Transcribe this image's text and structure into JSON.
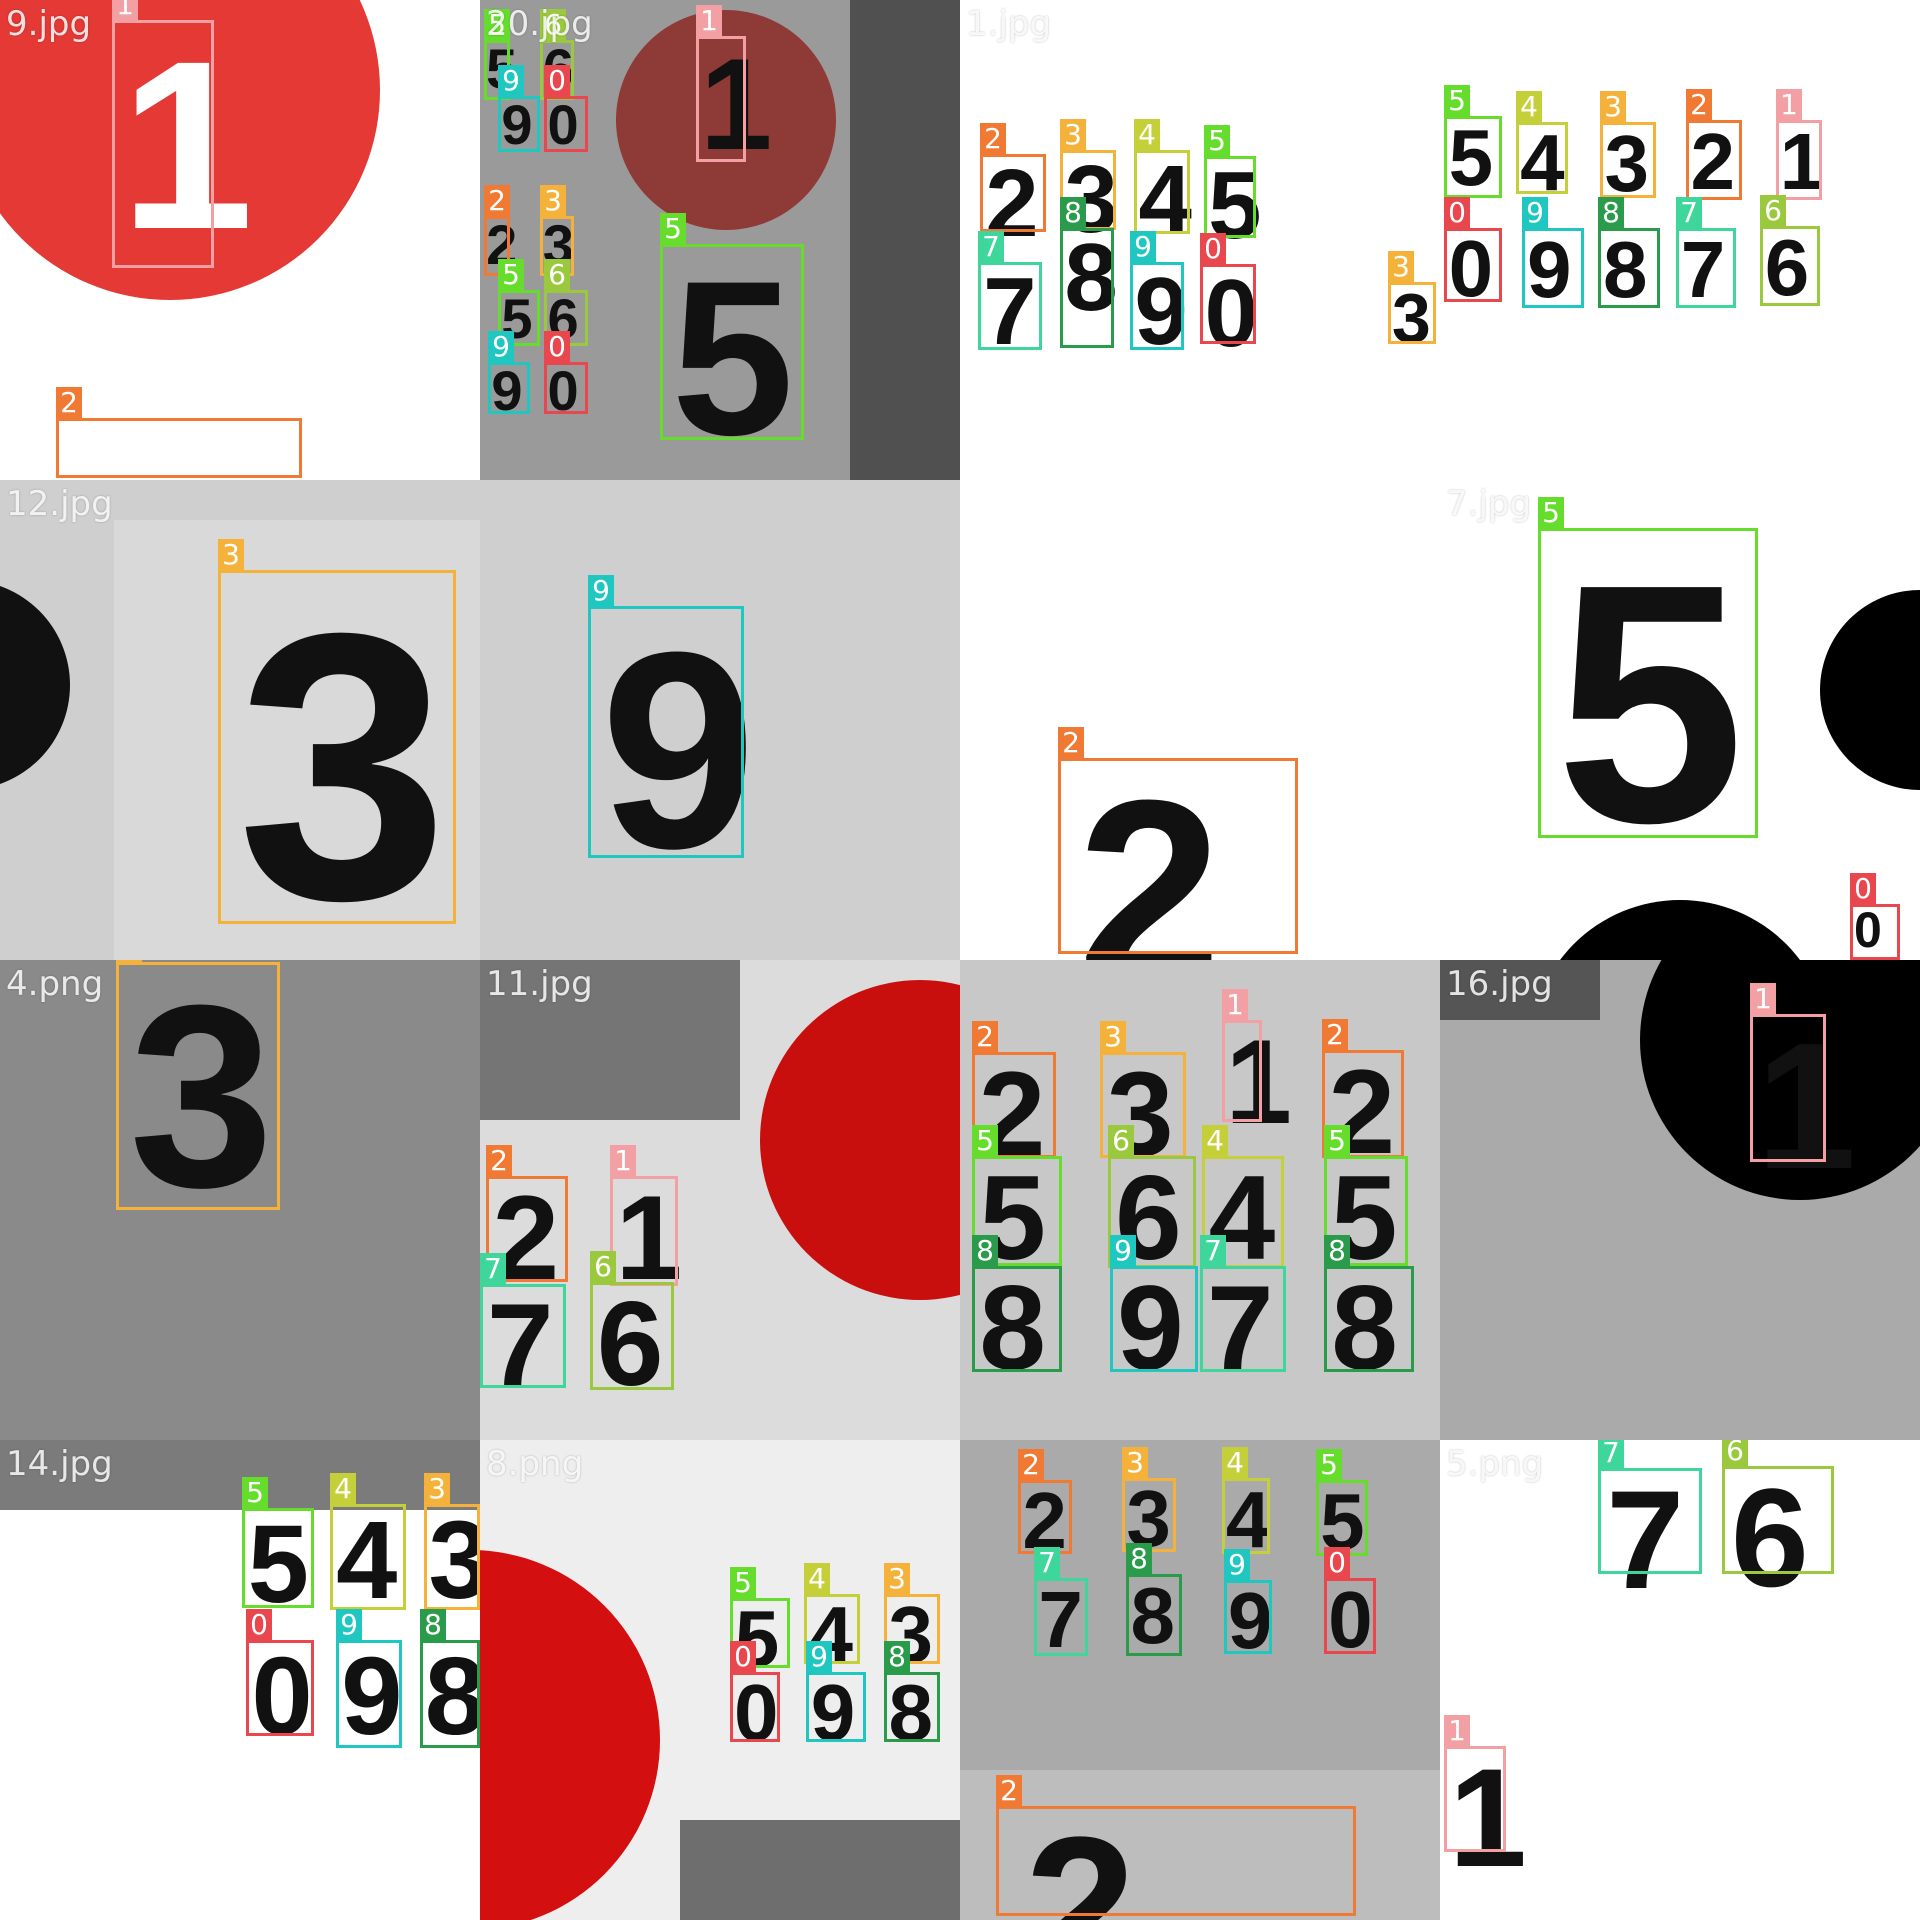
{
  "tiles": [
    {
      "name": "9.jpg",
      "bg": "#ffffff"
    },
    {
      "name": "20.jpg",
      "bg": "#9a9a9a"
    },
    {
      "name": "1.jpg",
      "bg": "#ffffff"
    },
    {
      "name": "",
      "bg": "#ffffff"
    },
    {
      "name": "12.jpg",
      "bg": "#cfcfcf"
    },
    {
      "name": "",
      "bg": "#cfcfcf"
    },
    {
      "name": "",
      "bg": "#ffffff"
    },
    {
      "name": "7.jpg",
      "bg": "#ffffff"
    },
    {
      "name": "4.png",
      "bg": "#8a8a8a"
    },
    {
      "name": "11.jpg",
      "bg": "#dcdcdc"
    },
    {
      "name": "",
      "bg": "#c8c8c8"
    },
    {
      "name": "16.jpg",
      "bg": "#aaaaaa"
    },
    {
      "name": "14.jpg",
      "bg": "#ffffff"
    },
    {
      "name": "8.png",
      "bg": "#eeeeee"
    },
    {
      "name": "",
      "bg": "#aaaaaa"
    },
    {
      "name": "5.png",
      "bg": "#ffffff"
    }
  ],
  "class_colors": {
    "0": "#e8474e",
    "1": "#f2a0a3",
    "2": "#f07a33",
    "3": "#f5b23a",
    "4": "#c5cf3a",
    "5": "#66dd2c",
    "6": "#9bc93d",
    "7": "#3ed69a",
    "8": "#2a9a4b",
    "9": "#1fc7c0"
  },
  "detections": [
    {
      "tile": 0,
      "label": "1",
      "big": true
    },
    {
      "tile": 0,
      "label": "2"
    },
    {
      "tile": 1,
      "label": "1"
    },
    {
      "tile": 1,
      "label": "5"
    },
    {
      "tile": 1,
      "label": "5"
    },
    {
      "tile": 1,
      "label": "6"
    },
    {
      "tile": 1,
      "label": "9"
    },
    {
      "tile": 1,
      "label": "0"
    },
    {
      "tile": 1,
      "label": "2"
    },
    {
      "tile": 1,
      "label": "3"
    },
    {
      "tile": 1,
      "label": "5"
    },
    {
      "tile": 1,
      "label": "6"
    },
    {
      "tile": 1,
      "label": "9"
    },
    {
      "tile": 1,
      "label": "0"
    },
    {
      "tile": 2,
      "label": "2"
    },
    {
      "tile": 2,
      "label": "3"
    },
    {
      "tile": 2,
      "label": "4"
    },
    {
      "tile": 2,
      "label": "5"
    },
    {
      "tile": 2,
      "label": "7"
    },
    {
      "tile": 2,
      "label": "8"
    },
    {
      "tile": 2,
      "label": "9"
    },
    {
      "tile": 2,
      "label": "0"
    },
    {
      "tile": 2,
      "label": "3"
    },
    {
      "tile": 3,
      "label": "5"
    },
    {
      "tile": 3,
      "label": "4"
    },
    {
      "tile": 3,
      "label": "3"
    },
    {
      "tile": 3,
      "label": "2"
    },
    {
      "tile": 3,
      "label": "1"
    },
    {
      "tile": 3,
      "label": "0"
    },
    {
      "tile": 3,
      "label": "9"
    },
    {
      "tile": 3,
      "label": "8"
    },
    {
      "tile": 3,
      "label": "7"
    },
    {
      "tile": 3,
      "label": "6"
    },
    {
      "tile": 4,
      "label": "3"
    },
    {
      "tile": 5,
      "label": "9"
    },
    {
      "tile": 6,
      "label": "2"
    },
    {
      "tile": 7,
      "label": "5"
    },
    {
      "tile": 7,
      "label": "0"
    },
    {
      "tile": 8,
      "label": "3"
    },
    {
      "tile": 9,
      "label": "2"
    },
    {
      "tile": 9,
      "label": "1"
    },
    {
      "tile": 9,
      "label": "7"
    },
    {
      "tile": 9,
      "label": "6"
    },
    {
      "tile": 10,
      "label": "2"
    },
    {
      "tile": 10,
      "label": "3"
    },
    {
      "tile": 10,
      "label": "1"
    },
    {
      "tile": 10,
      "label": "2"
    },
    {
      "tile": 10,
      "label": "5"
    },
    {
      "tile": 10,
      "label": "6"
    },
    {
      "tile": 10,
      "label": "4"
    },
    {
      "tile": 10,
      "label": "5"
    },
    {
      "tile": 10,
      "label": "8"
    },
    {
      "tile": 10,
      "label": "9"
    },
    {
      "tile": 10,
      "label": "7"
    },
    {
      "tile": 10,
      "label": "8"
    },
    {
      "tile": 11,
      "label": "1"
    },
    {
      "tile": 12,
      "label": "5"
    },
    {
      "tile": 12,
      "label": "4"
    },
    {
      "tile": 12,
      "label": "3"
    },
    {
      "tile": 12,
      "label": "0"
    },
    {
      "tile": 12,
      "label": "9"
    },
    {
      "tile": 12,
      "label": "8"
    },
    {
      "tile": 13,
      "label": "5"
    },
    {
      "tile": 13,
      "label": "4"
    },
    {
      "tile": 13,
      "label": "3"
    },
    {
      "tile": 13,
      "label": "0"
    },
    {
      "tile": 13,
      "label": "9"
    },
    {
      "tile": 13,
      "label": "8"
    },
    {
      "tile": 14,
      "label": "2"
    },
    {
      "tile": 14,
      "label": "3"
    },
    {
      "tile": 14,
      "label": "4"
    },
    {
      "tile": 14,
      "label": "5"
    },
    {
      "tile": 14,
      "label": "7"
    },
    {
      "tile": 14,
      "label": "8"
    },
    {
      "tile": 14,
      "label": "9"
    },
    {
      "tile": 14,
      "label": "0"
    },
    {
      "tile": 14,
      "label": "2"
    },
    {
      "tile": 15,
      "label": "7"
    },
    {
      "tile": 15,
      "label": "6"
    },
    {
      "tile": 15,
      "label": "1"
    }
  ]
}
